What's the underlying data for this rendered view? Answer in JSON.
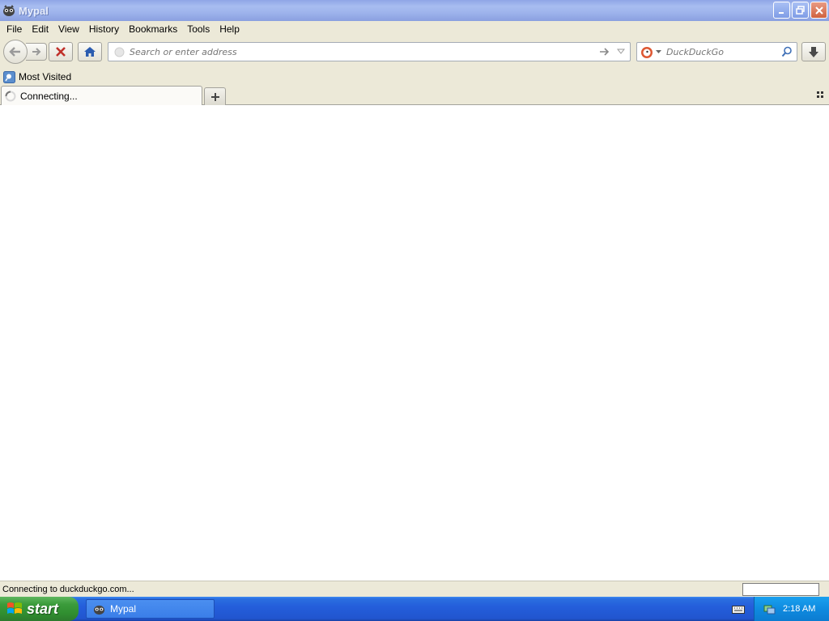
{
  "window": {
    "title": "Mypal"
  },
  "menu": [
    "File",
    "Edit",
    "View",
    "History",
    "Bookmarks",
    "Tools",
    "Help"
  ],
  "navbar": {
    "url_placeholder": "Search or enter address",
    "url_value": "",
    "search_placeholder": "DuckDuckGo",
    "search_engine_icon": "duckduckgo-icon"
  },
  "bookmarks": {
    "items": [
      {
        "label": "Most Visited"
      }
    ]
  },
  "tabs": [
    {
      "label": "Connecting...",
      "loading": true
    }
  ],
  "statusbar": {
    "text": "Connecting to duckduckgo.com..."
  },
  "taskbar": {
    "start_label": "start",
    "items": [
      {
        "label": "Mypal"
      }
    ],
    "clock": "2:18 AM"
  },
  "colors": {
    "titlebar": "#9eb3ec",
    "taskbar": "#245edb",
    "start": "#3c9c3c",
    "chrome": "#ece9d8"
  }
}
